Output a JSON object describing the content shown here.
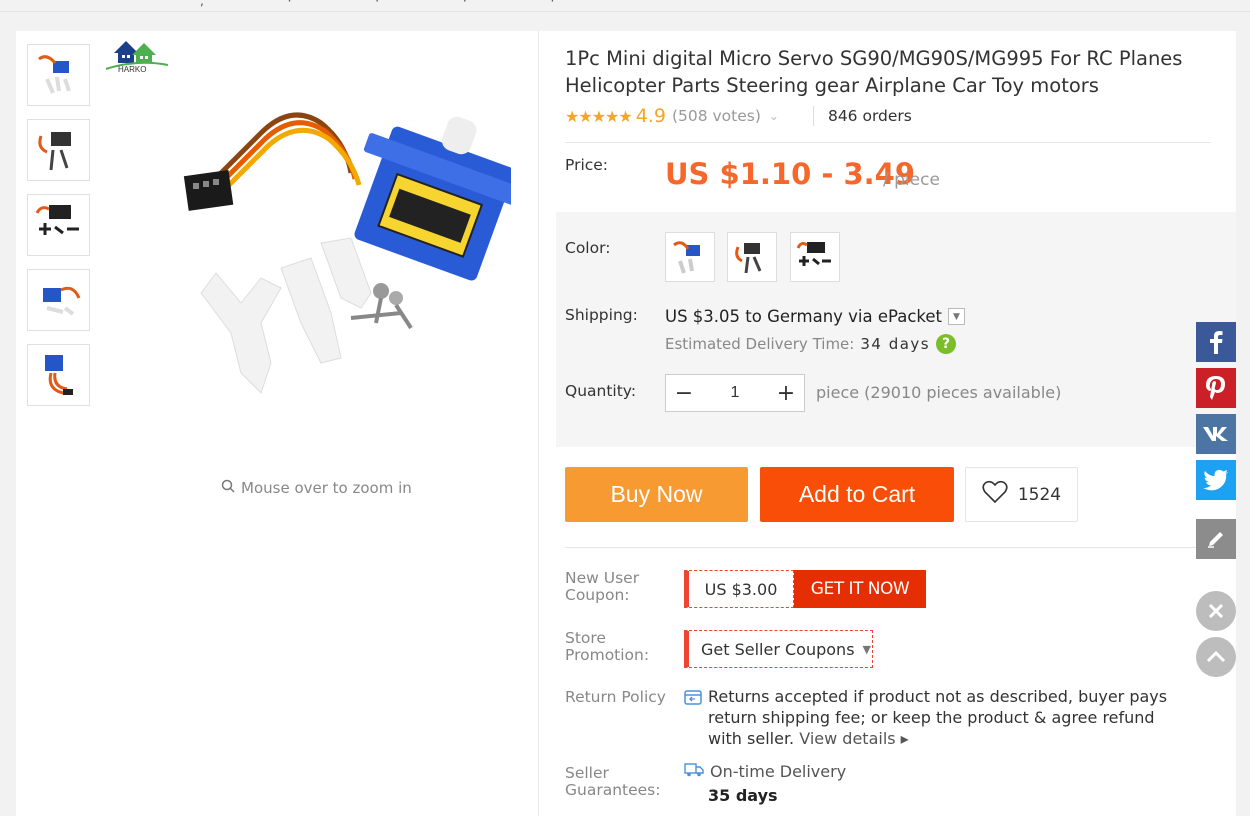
{
  "product": {
    "title": "1Pc Mini digital Micro Servo SG90/MG90S/MG995 For RC Planes Helicopter Parts Steering gear Airplane Car Toy motors",
    "stars": "★★★★★",
    "rating": "4.9",
    "votes": "(508 votes)",
    "orders": "846 orders"
  },
  "brand": {
    "logo_text": "HARKO"
  },
  "gallery": {
    "zoom_hint": "Mouse over to zoom in"
  },
  "price": {
    "label": "Price:",
    "value": "US $1.10 - 3.49",
    "unit": "/ piece"
  },
  "color": {
    "label": "Color:"
  },
  "shipping": {
    "label": "Shipping:",
    "text": "US $3.05 to Germany via ePacket",
    "estimate_label": "Estimated Delivery Time:",
    "estimate_value": "34 days",
    "help": "?"
  },
  "quantity": {
    "label": "Quantity:",
    "value": "1",
    "available": "piece (29010 pieces available)"
  },
  "actions": {
    "buy_now": "Buy Now",
    "add_to_cart": "Add to Cart",
    "wishlist_count": "1524"
  },
  "coupon": {
    "label": "New User Coupon:",
    "amount": "US $3.00",
    "cta": "GET IT NOW"
  },
  "promotion": {
    "label": "Store Promotion:",
    "cta": "Get Seller Coupons"
  },
  "return_policy": {
    "label": "Return Policy",
    "text": "Returns accepted if product not as described, buyer pays return shipping fee; or keep the product & agree refund with seller.",
    "link": "View details"
  },
  "guarantees": {
    "label": "Seller Guarantees:",
    "service": "On-time Delivery",
    "days": "35 days"
  },
  "colors": {
    "accent_orange": "#f69a31",
    "cart_red": "#f84e07",
    "price_orange": "#f5672a",
    "facebook": "#3b5998",
    "pinterest": "#cb2027",
    "vk": "#4c75a3",
    "twitter": "#1da1f2"
  },
  "icons": [
    "facebook-icon",
    "pinterest-icon",
    "vk-icon",
    "twitter-icon",
    "edit-icon",
    "close-icon",
    "scroll-top-icon",
    "heart-icon",
    "zoom-icon"
  ]
}
